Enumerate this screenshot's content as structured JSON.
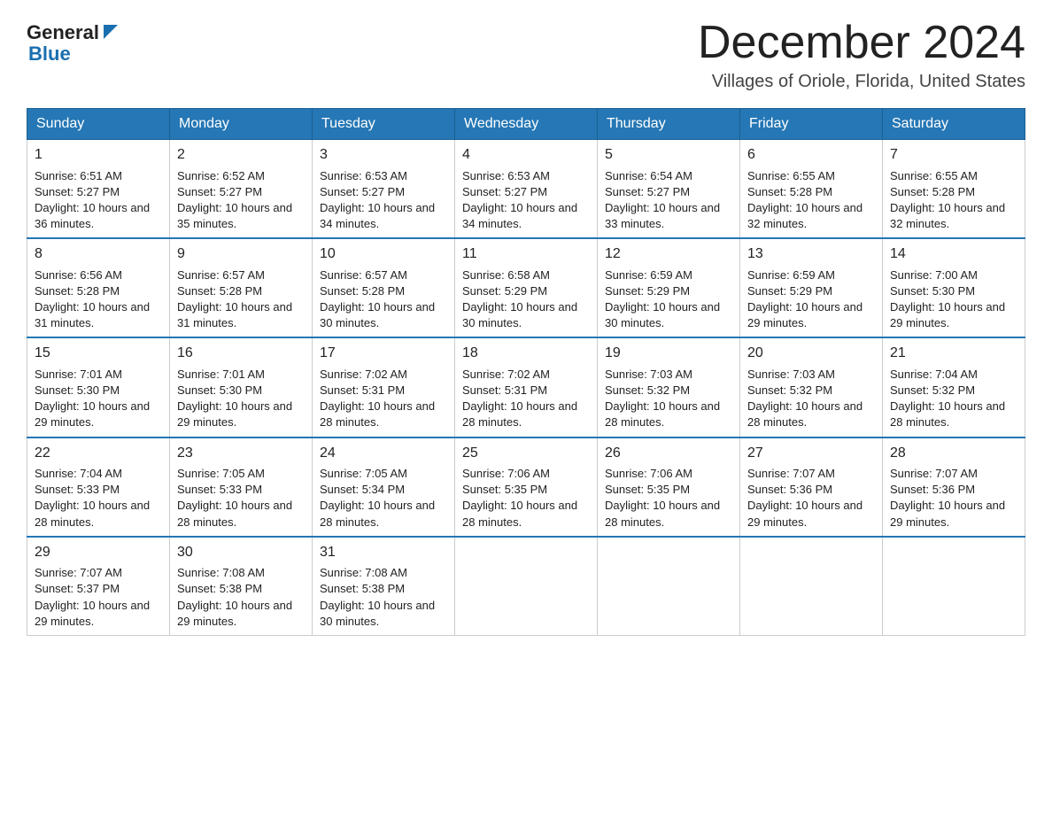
{
  "header": {
    "logo_general": "General",
    "logo_blue": "Blue",
    "month_title": "December 2024",
    "subtitle": "Villages of Oriole, Florida, United States"
  },
  "weekdays": [
    "Sunday",
    "Monday",
    "Tuesday",
    "Wednesday",
    "Thursday",
    "Friday",
    "Saturday"
  ],
  "weeks": [
    [
      {
        "day": "1",
        "sunrise": "6:51 AM",
        "sunset": "5:27 PM",
        "daylight": "10 hours and 36 minutes."
      },
      {
        "day": "2",
        "sunrise": "6:52 AM",
        "sunset": "5:27 PM",
        "daylight": "10 hours and 35 minutes."
      },
      {
        "day": "3",
        "sunrise": "6:53 AM",
        "sunset": "5:27 PM",
        "daylight": "10 hours and 34 minutes."
      },
      {
        "day": "4",
        "sunrise": "6:53 AM",
        "sunset": "5:27 PM",
        "daylight": "10 hours and 34 minutes."
      },
      {
        "day": "5",
        "sunrise": "6:54 AM",
        "sunset": "5:27 PM",
        "daylight": "10 hours and 33 minutes."
      },
      {
        "day": "6",
        "sunrise": "6:55 AM",
        "sunset": "5:28 PM",
        "daylight": "10 hours and 32 minutes."
      },
      {
        "day": "7",
        "sunrise": "6:55 AM",
        "sunset": "5:28 PM",
        "daylight": "10 hours and 32 minutes."
      }
    ],
    [
      {
        "day": "8",
        "sunrise": "6:56 AM",
        "sunset": "5:28 PM",
        "daylight": "10 hours and 31 minutes."
      },
      {
        "day": "9",
        "sunrise": "6:57 AM",
        "sunset": "5:28 PM",
        "daylight": "10 hours and 31 minutes."
      },
      {
        "day": "10",
        "sunrise": "6:57 AM",
        "sunset": "5:28 PM",
        "daylight": "10 hours and 30 minutes."
      },
      {
        "day": "11",
        "sunrise": "6:58 AM",
        "sunset": "5:29 PM",
        "daylight": "10 hours and 30 minutes."
      },
      {
        "day": "12",
        "sunrise": "6:59 AM",
        "sunset": "5:29 PM",
        "daylight": "10 hours and 30 minutes."
      },
      {
        "day": "13",
        "sunrise": "6:59 AM",
        "sunset": "5:29 PM",
        "daylight": "10 hours and 29 minutes."
      },
      {
        "day": "14",
        "sunrise": "7:00 AM",
        "sunset": "5:30 PM",
        "daylight": "10 hours and 29 minutes."
      }
    ],
    [
      {
        "day": "15",
        "sunrise": "7:01 AM",
        "sunset": "5:30 PM",
        "daylight": "10 hours and 29 minutes."
      },
      {
        "day": "16",
        "sunrise": "7:01 AM",
        "sunset": "5:30 PM",
        "daylight": "10 hours and 29 minutes."
      },
      {
        "day": "17",
        "sunrise": "7:02 AM",
        "sunset": "5:31 PM",
        "daylight": "10 hours and 28 minutes."
      },
      {
        "day": "18",
        "sunrise": "7:02 AM",
        "sunset": "5:31 PM",
        "daylight": "10 hours and 28 minutes."
      },
      {
        "day": "19",
        "sunrise": "7:03 AM",
        "sunset": "5:32 PM",
        "daylight": "10 hours and 28 minutes."
      },
      {
        "day": "20",
        "sunrise": "7:03 AM",
        "sunset": "5:32 PM",
        "daylight": "10 hours and 28 minutes."
      },
      {
        "day": "21",
        "sunrise": "7:04 AM",
        "sunset": "5:32 PM",
        "daylight": "10 hours and 28 minutes."
      }
    ],
    [
      {
        "day": "22",
        "sunrise": "7:04 AM",
        "sunset": "5:33 PM",
        "daylight": "10 hours and 28 minutes."
      },
      {
        "day": "23",
        "sunrise": "7:05 AM",
        "sunset": "5:33 PM",
        "daylight": "10 hours and 28 minutes."
      },
      {
        "day": "24",
        "sunrise": "7:05 AM",
        "sunset": "5:34 PM",
        "daylight": "10 hours and 28 minutes."
      },
      {
        "day": "25",
        "sunrise": "7:06 AM",
        "sunset": "5:35 PM",
        "daylight": "10 hours and 28 minutes."
      },
      {
        "day": "26",
        "sunrise": "7:06 AM",
        "sunset": "5:35 PM",
        "daylight": "10 hours and 28 minutes."
      },
      {
        "day": "27",
        "sunrise": "7:07 AM",
        "sunset": "5:36 PM",
        "daylight": "10 hours and 29 minutes."
      },
      {
        "day": "28",
        "sunrise": "7:07 AM",
        "sunset": "5:36 PM",
        "daylight": "10 hours and 29 minutes."
      }
    ],
    [
      {
        "day": "29",
        "sunrise": "7:07 AM",
        "sunset": "5:37 PM",
        "daylight": "10 hours and 29 minutes."
      },
      {
        "day": "30",
        "sunrise": "7:08 AM",
        "sunset": "5:38 PM",
        "daylight": "10 hours and 29 minutes."
      },
      {
        "day": "31",
        "sunrise": "7:08 AM",
        "sunset": "5:38 PM",
        "daylight": "10 hours and 30 minutes."
      },
      null,
      null,
      null,
      null
    ]
  ]
}
